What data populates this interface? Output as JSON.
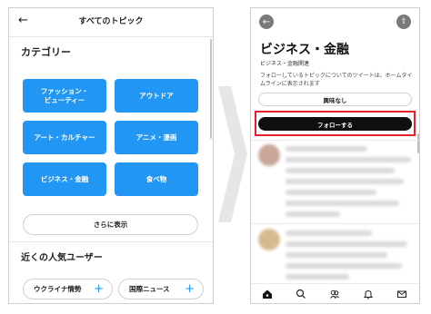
{
  "left_screen": {
    "header": {
      "back_icon": "arrow-left-icon",
      "title": "すべてのトピック"
    },
    "categories": {
      "title": "カテゴリー",
      "tiles": [
        {
          "label": "ファッション・\nビューティー"
        },
        {
          "label": "アウトドア"
        },
        {
          "label": "アート・カルチャー"
        },
        {
          "label": "アニメ・漫画"
        },
        {
          "label": "ビジネス・金融"
        },
        {
          "label": "食べ物"
        }
      ],
      "tile_color": "#2196f3",
      "more_label": "さらに表示"
    },
    "popular_users": {
      "title": "近くの人気ユーザー",
      "chips": [
        {
          "label": "ウクライナ情勢"
        },
        {
          "label": "国際ニュース"
        }
      ]
    }
  },
  "right_screen": {
    "back_icon": "arrow-left-icon",
    "share_icon": "share-icon",
    "topic_title": "ビジネス・金融",
    "topic_subtitle": "ビジネス・金融関連",
    "description": "フォローしているトピックについてのツイートは、ホームタイムラインに表示されます",
    "not_interested_label": "興味なし",
    "follow_label": "フォローする",
    "highlight_color": "#e8202a",
    "bottom_nav": [
      "home-icon",
      "search-icon",
      "communities-icon",
      "notifications-icon",
      "messages-icon"
    ]
  }
}
